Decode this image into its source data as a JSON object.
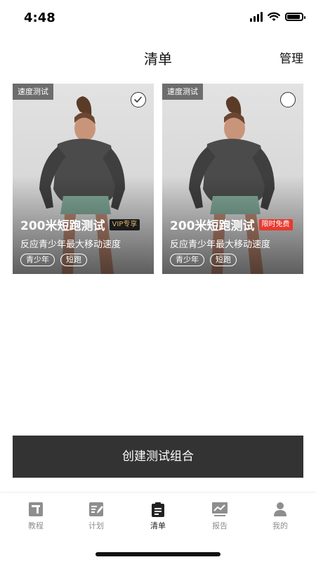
{
  "status_bar": {
    "time": "4:48"
  },
  "nav": {
    "title": "清单",
    "manage": "管理"
  },
  "cards": [
    {
      "category": "速度测试",
      "title": "200米短跑测试",
      "badge": "VIP专享",
      "subtitle": "反应青少年最大移动速度",
      "tags": [
        "青少年",
        "短跑"
      ],
      "selected": true
    },
    {
      "category": "速度测试",
      "title": "200米短跑测试",
      "badge": "限时免费",
      "subtitle": "反应青少年最大移动速度",
      "tags": [
        "青少年",
        "短跑"
      ],
      "selected": false
    }
  ],
  "create_button": "创建测试组合",
  "tabs": [
    {
      "label": "教程",
      "icon": "tutorial-icon"
    },
    {
      "label": "计划",
      "icon": "plan-icon"
    },
    {
      "label": "清单",
      "icon": "list-icon",
      "active": true
    },
    {
      "label": "报告",
      "icon": "report-icon"
    },
    {
      "label": "我的",
      "icon": "profile-icon"
    }
  ],
  "colors": {
    "accent_dark": "#333333",
    "vip_gold": "#d8b26a",
    "free_red": "#e83a2f",
    "tab_inactive": "#8e8e8e"
  }
}
